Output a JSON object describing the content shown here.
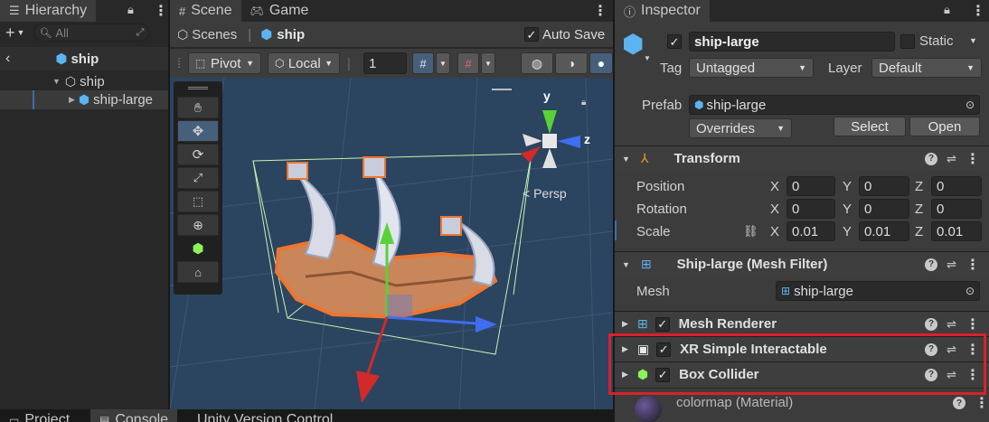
{
  "hierarchy": {
    "tab_label": "Hierarchy",
    "search_placeholder": "All",
    "scene_name": "ship",
    "items": [
      {
        "label": "ship"
      },
      {
        "label": "ship-large"
      }
    ]
  },
  "scene": {
    "tab_label": "Scene",
    "game_tab_label": "Game",
    "breadcrumb_root": "Scenes",
    "breadcrumb_current": "ship",
    "auto_save_label": "Auto Save",
    "pivot_label": "Pivot",
    "local_label": "Local",
    "grid_value": "1",
    "persp_label": "< Persp",
    "axis_y": "y",
    "axis_z": "z"
  },
  "bottom_tabs": {
    "project": "Project",
    "console": "Console",
    "version_control": "Unity Version Control"
  },
  "inspector": {
    "tab_label": "Inspector",
    "object_name": "ship-large",
    "static_label": "Static",
    "tag_label": "Tag",
    "tag_value": "Untagged",
    "layer_label": "Layer",
    "layer_value": "Default",
    "prefab_label": "Prefab",
    "prefab_value": "ship-large",
    "overrides_label": "Overrides",
    "select_label": "Select",
    "open_label": "Open",
    "transform": {
      "title": "Transform",
      "position_label": "Position",
      "rotation_label": "Rotation",
      "scale_label": "Scale",
      "x": "X",
      "y": "Y",
      "z": "Z",
      "position": [
        "0",
        "0",
        "0"
      ],
      "rotation": [
        "0",
        "0",
        "0"
      ],
      "scale": [
        "0.01",
        "0.01",
        "0.01"
      ]
    },
    "mesh_filter": {
      "title": "Ship-large (Mesh Filter)",
      "mesh_label": "Mesh",
      "mesh_value": "ship-large"
    },
    "mesh_renderer_title": "Mesh Renderer",
    "xr_title": "XR Simple Interactable",
    "box_collider_title": "Box Collider",
    "material_label": "colormap (Material)"
  },
  "colors": {
    "highlight_box": "#d8222a",
    "scene_bg": "#2b4460",
    "accent_blue": "#3d6ea8"
  }
}
